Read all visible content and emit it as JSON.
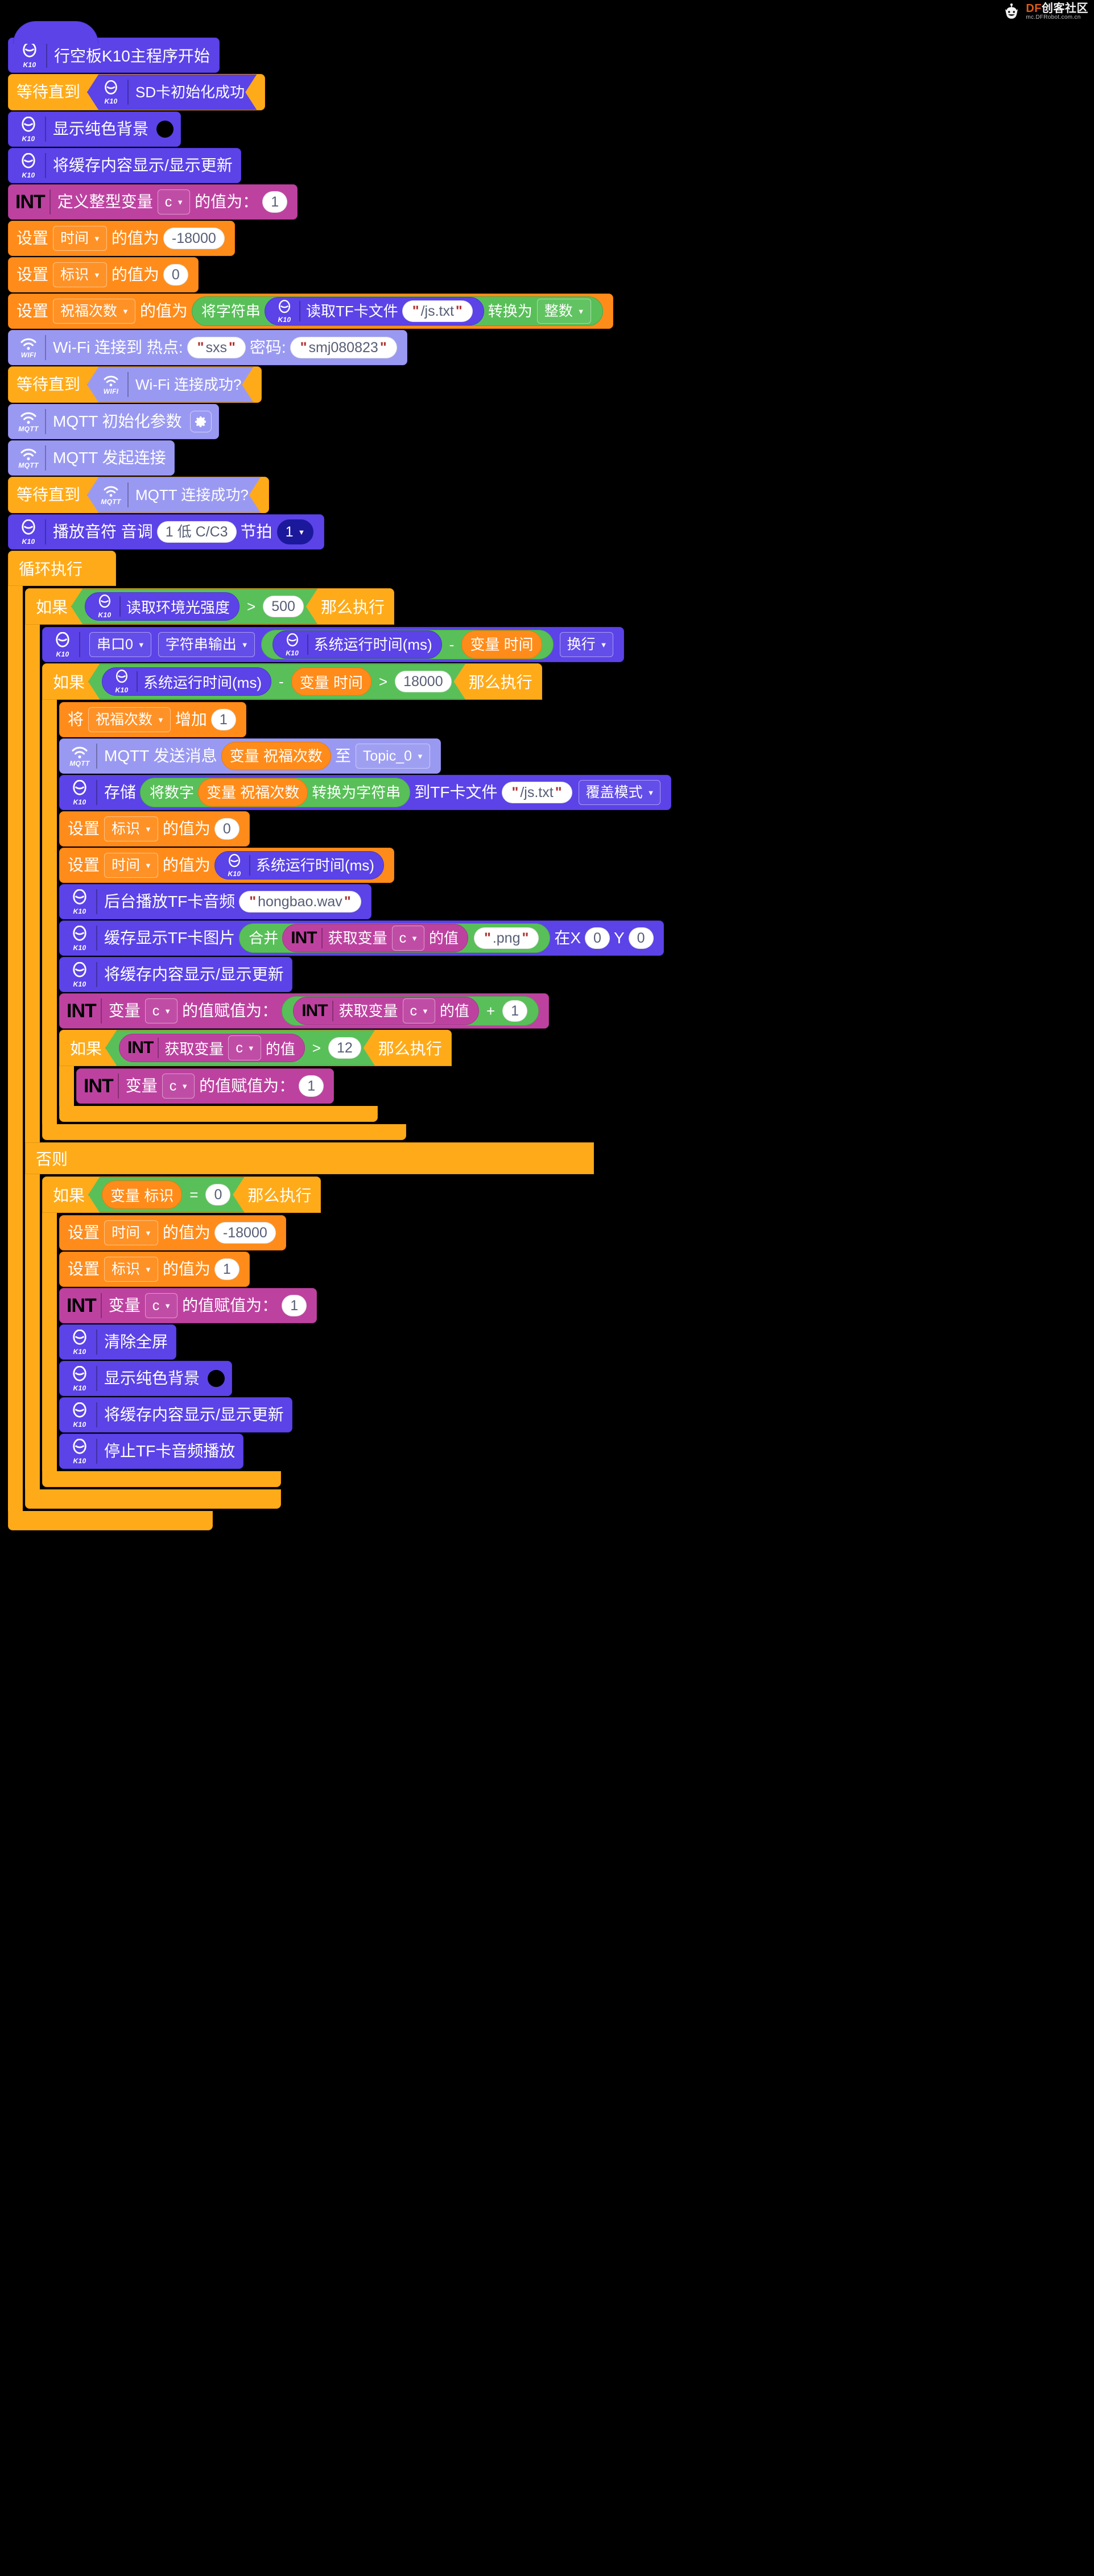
{
  "watermark": {
    "title_prefix": "DF",
    "title_suffix": "创客社区",
    "subtitle": "mc.DFRobot.com.cn"
  },
  "badges": {
    "k10": "K10",
    "wifi": "WIFI",
    "mqtt": "MQTT"
  },
  "colors": {
    "k10_block": "#5b43e8",
    "network_block": "#9a99f2",
    "control_block": "#ffab19",
    "variable_block": "#ff8c1a",
    "operator_block": "#59c059",
    "int_block": "#bd42a0",
    "dropdown_dark": "#1b189c",
    "canvas": "#000000",
    "swatch_black": "#000000"
  },
  "script": {
    "hat": {
      "label": "行空板K10主程序开始"
    },
    "wait_sd": {
      "wait_label": "等待直到",
      "condition": "SD卡初始化成功"
    },
    "show_solid_bg": {
      "label": "显示纯色背景",
      "color": "#000000"
    },
    "buffer_update": {
      "label": "将缓存内容显示/显示更新"
    },
    "define_int": {
      "badge": "INT",
      "label": "定义整型变量",
      "variable": "c",
      "mid_label": "的值为：",
      "value": "1"
    },
    "set_time": {
      "set": "设置",
      "variable": "时间",
      "mid": "的值为",
      "value": "-18000"
    },
    "set_flag": {
      "set": "设置",
      "variable": "标识",
      "mid": "的值为",
      "value": "0"
    },
    "set_count": {
      "set": "设置",
      "variable": "祝福次数",
      "mid": "的值为",
      "convert_prefix": "将字符串",
      "read_tf": "读取TF卡文件",
      "file": "/js.txt",
      "convert_mid": "转换为",
      "convert_type": "整数"
    },
    "wifi_connect": {
      "label": "Wi-Fi 连接到 热点:",
      "ssid": "sxs",
      "pwd_label": "密码:",
      "password": "smj080823"
    },
    "wait_wifi": {
      "wait_label": "等待直到",
      "condition": "Wi-Fi 连接成功?"
    },
    "mqtt_init": {
      "label": "MQTT 初始化参数"
    },
    "mqtt_connect": {
      "label": "MQTT 发起连接"
    },
    "wait_mqtt": {
      "wait_label": "等待直到",
      "condition": "MQTT 连接成功?"
    },
    "play_note": {
      "label": "播放音符 音调",
      "tone": "1 低 C/C3",
      "beat_label": "节拍",
      "beat": "1"
    },
    "forever": {
      "label": "循环执行"
    },
    "if_light": {
      "if_label": "如果",
      "sensor": "读取环境光强度",
      "operator": ">",
      "value": "500",
      "then_label": "那么执行"
    },
    "serial_print": {
      "port": "串口0",
      "mode": "字符串输出",
      "runtime": "系统运行时间(ms)",
      "minus": "-",
      "var_time": "变量 时间",
      "newline": "换行"
    },
    "if_elapsed": {
      "if_label": "如果",
      "runtime": "系统运行时间(ms)",
      "minus": "-",
      "var_time": "变量 时间",
      "operator": ">",
      "value": "18000",
      "then_label": "那么执行"
    },
    "change_count": {
      "prefix": "将",
      "variable": "祝福次数",
      "mid": "增加",
      "value": "1"
    },
    "mqtt_publish": {
      "label": "MQTT 发送消息",
      "payload": "变量 祝福次数",
      "to_label": "至",
      "topic": "Topic_0"
    },
    "save_tf": {
      "store_label": "存储",
      "num_to_str_prefix": "将数字",
      "payload": "变量 祝福次数",
      "num_to_str_suffix": "转换为字符串",
      "to_file_label": "到TF卡文件",
      "file": "/js.txt",
      "mode": "覆盖模式"
    },
    "set_flag_0": {
      "set": "设置",
      "variable": "标识",
      "mid": "的值为",
      "value": "0"
    },
    "set_time_runtime": {
      "set": "设置",
      "variable": "时间",
      "mid": "的值为",
      "runtime": "系统运行时间(ms)"
    },
    "play_audio": {
      "label": "后台播放TF卡音频",
      "file": "hongbao.wav"
    },
    "show_image": {
      "label": "缓存显示TF卡图片",
      "join_label": "合并",
      "badge": "INT",
      "get_var_label": "获取变量",
      "variable": "c",
      "of_value": "的值",
      "suffix": ".png",
      "x_label": "在X",
      "x": "0",
      "y_label": "Y",
      "y": "0"
    },
    "buffer_update2": {
      "label": "将缓存内容显示/显示更新"
    },
    "inc_c": {
      "badge": "INT",
      "var_label": "变量",
      "variable": "c",
      "assign_label": "的值赋值为：",
      "get_badge": "INT",
      "get_var_label": "获取变量",
      "get_variable": "c",
      "of_value": "的值",
      "operator": "+",
      "operand": "1"
    },
    "if_c_gt": {
      "if_label": "如果",
      "badge": "INT",
      "get_var_label": "获取变量",
      "variable": "c",
      "of_value": "的值",
      "operator": ">",
      "value": "12",
      "then_label": "那么执行"
    },
    "reset_c": {
      "badge": "INT",
      "var_label": "变量",
      "variable": "c",
      "assign_label": "的值赋值为：",
      "value": "1"
    },
    "else_label": "否则",
    "if_flag": {
      "if_label": "如果",
      "var_flag": "变量 标识",
      "operator": "=",
      "value": "0",
      "then_label": "那么执行"
    },
    "else_set_time": {
      "set": "设置",
      "variable": "时间",
      "mid": "的值为",
      "value": "-18000"
    },
    "else_set_flag": {
      "set": "设置",
      "variable": "标识",
      "mid": "的值为",
      "value": "1"
    },
    "else_set_c": {
      "badge": "INT",
      "var_label": "变量",
      "variable": "c",
      "assign_label": "的值赋值为：",
      "value": "1"
    },
    "clear_screen": {
      "label": "清除全屏"
    },
    "else_show_bg": {
      "label": "显示纯色背景",
      "color": "#000000"
    },
    "else_buffer_update": {
      "label": "将缓存内容显示/显示更新"
    },
    "stop_audio": {
      "label": "停止TF卡音频播放"
    }
  }
}
